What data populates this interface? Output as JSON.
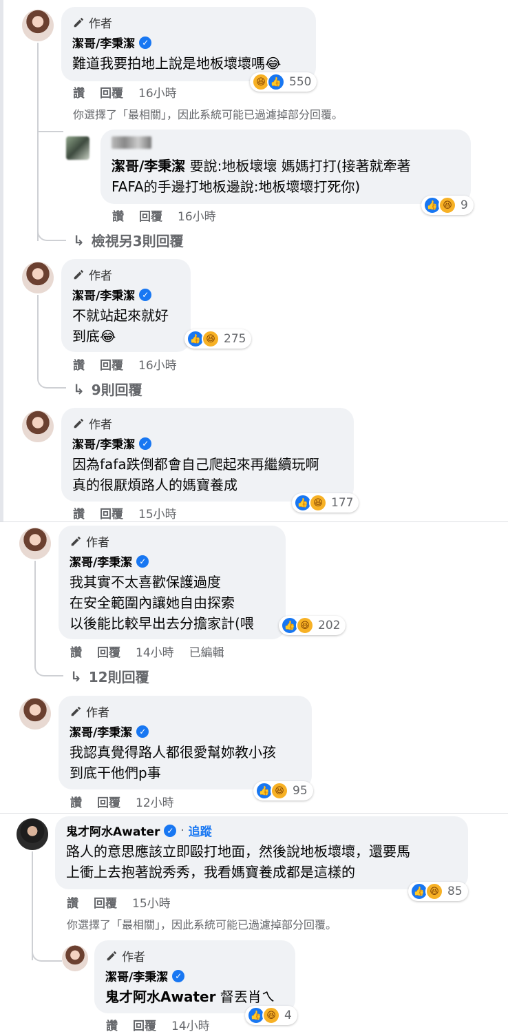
{
  "author_tag": "作者",
  "actions": {
    "like": "讚",
    "reply": "回覆",
    "edited": "已編輯"
  },
  "filter_note": "你選擇了「最相關」，因此系統可能已過濾掉部分回覆。",
  "comments": [
    {
      "name": "潔哥/李秉潔",
      "text": "難道我要拍地上說是地板壞壞嗎😂",
      "count": "550",
      "time": "16小時"
    },
    {
      "name": "潔哥/李秉潔",
      "mention": "潔哥/李秉潔",
      "text": " 要說:地板壞壞 媽媽打打(接著就牽著\nFAFA的手邊打地板邊說:地板壞壞打死你)",
      "count": "9",
      "time": "16小時",
      "more": "檢視另3則回覆"
    },
    {
      "name": "潔哥/李秉潔",
      "text": "不就站起來就好\n到底😂",
      "count": "275",
      "time": "16小時",
      "more": "9則回覆"
    },
    {
      "name": "潔哥/李秉潔",
      "text": "因為fafa跌倒都會自己爬起來再繼續玩啊\n真的很厭煩路人的媽寶養成",
      "count": "177",
      "time": "15小時"
    },
    {
      "name": "潔哥/李秉潔",
      "text": "我其實不太喜歡保護過度\n在安全範圍內讓她自由探索\n以後能比較早出去分擔家計(喂",
      "count": "202",
      "time": "14小時",
      "more": "12則回覆"
    },
    {
      "name": "潔哥/李秉潔",
      "text": "我認真覺得路人都很愛幫妳教小孩\n到底干他們p事",
      "count": "95",
      "time": "12小時"
    },
    {
      "name": "鬼才阿水Awater",
      "follow": "追蹤",
      "text": "路人的意思應該立即毆打地面，然後說地板壞壞，還要馬\n上衝上去抱著說秀秀，我看媽寶養成都是這樣的",
      "count": "85",
      "time": "15小時"
    },
    {
      "name": "潔哥/李秉潔",
      "mention": "鬼才阿水Awater",
      "text": " 督丟肖ㄟ",
      "count": "4",
      "time": "14小時"
    }
  ],
  "colors": {
    "bubble": "#f0f2f5",
    "meta": "#65676b",
    "verified": "#1877f2",
    "like": "#1877f2",
    "haha": "#f7b125"
  }
}
